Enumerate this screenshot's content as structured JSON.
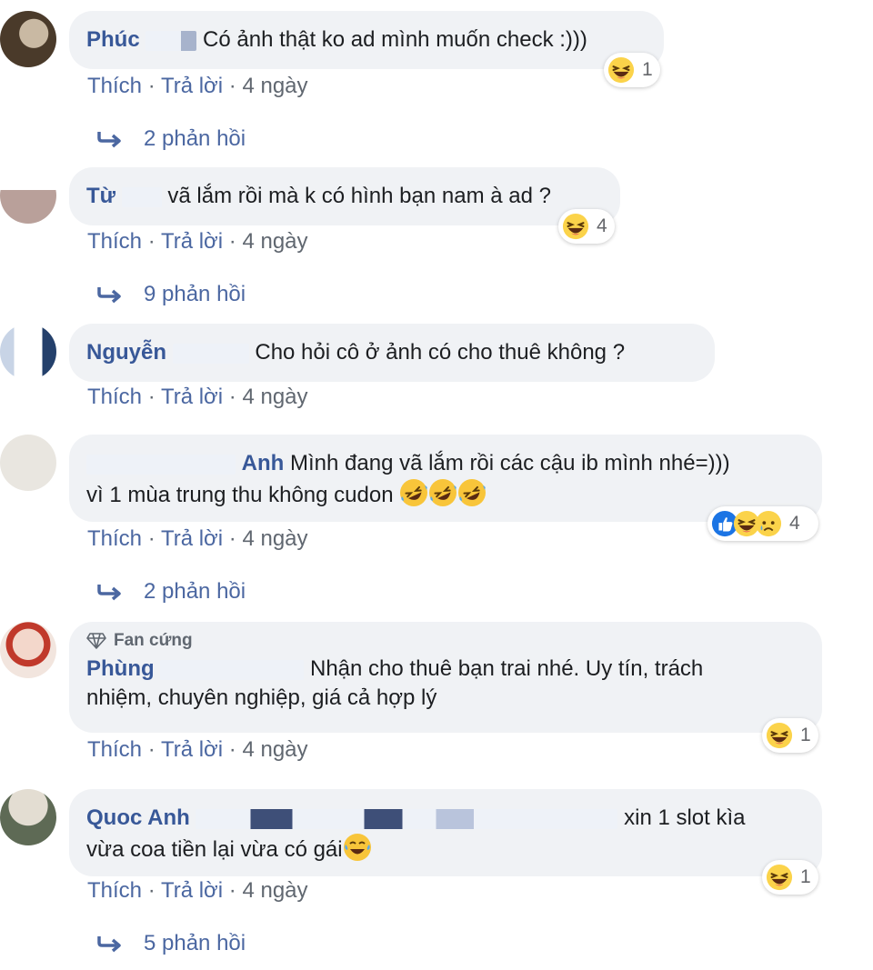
{
  "ui": {
    "like": "Thích",
    "reply": "Trả lời",
    "separator": "·",
    "time": "4 ngày"
  },
  "colors": {
    "author": "#385898",
    "bubble": "#f0f2f5",
    "link": "#4b67a1",
    "meta": "#606770"
  },
  "comments": [
    {
      "author": "Phúc",
      "text": "Có ảnh thật ko ad mình muốn check :)))",
      "reaction_icons": [
        "haha-icon"
      ],
      "reaction_count": "1",
      "replies": "2 phản hồi"
    },
    {
      "author": "Từ",
      "author_tail": "...n",
      "text": "vã lắm rồi mà k có hình bạn nam à ad ?",
      "reaction_icons": [
        "haha-icon"
      ],
      "reaction_count": "4",
      "replies": "9 phản hồi"
    },
    {
      "author": "Nguyễn",
      "author_tail": "i",
      "text": "Cho hỏi cô ở ảnh có cho thuê không ?",
      "reaction_icons": [],
      "reaction_count": "",
      "replies": ""
    },
    {
      "author": "Anh",
      "text_line1": "Mình đang vã lắm rồi các cậu ib mình nhé=)))",
      "text_line2": "vì 1 mùa trung thu không cudon",
      "inline_emoji": [
        "rofl-icon",
        "rofl-icon",
        "rofl-icon"
      ],
      "reaction_icons": [
        "like-icon",
        "haha-icon",
        "sad-icon"
      ],
      "reaction_count": "4",
      "replies": "2 phản hồi"
    },
    {
      "badge": "Fan cứng",
      "author": "Phùng",
      "text_line1": "Nhận cho thuê bạn trai nhé. Uy tín, trách",
      "text_line2": "nhiệm, chuyên nghiệp, giá cả hợp lý",
      "reaction_icons": [
        "haha-icon"
      ],
      "reaction_count": "1",
      "replies": ""
    },
    {
      "author": "Quoc Anh",
      "text_line1": "xin 1 slot kìa",
      "text_line2": "vừa coa tiền lại vừa có gái",
      "inline_emoji": [
        "joy-icon"
      ],
      "reaction_icons": [
        "haha-icon"
      ],
      "reaction_count": "1",
      "replies": "5 phản hồi"
    }
  ]
}
